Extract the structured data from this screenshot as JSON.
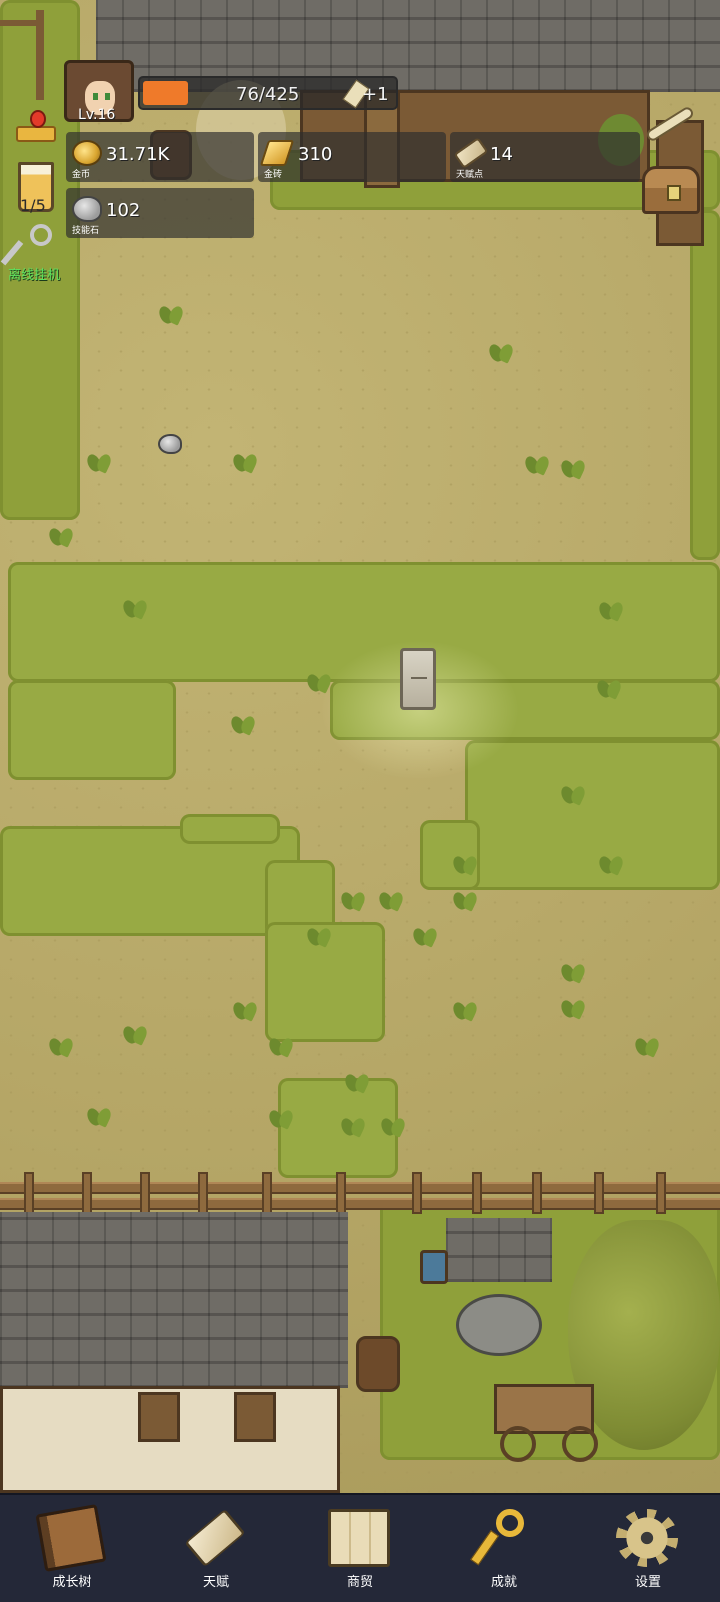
{
  "player": {
    "level_label": "Lv.16",
    "xp_text": "76/425",
    "xp_fraction": 0.179,
    "xp_bonus": "+1"
  },
  "resources": [
    {
      "id": "gold",
      "value": "31.71K",
      "label": "金币",
      "icon": "gold-coin-icon"
    },
    {
      "id": "gold-bar",
      "value": "310",
      "label": "金砖",
      "icon": "gold-bar-icon"
    },
    {
      "id": "talent",
      "value": "14",
      "label": "天赋点",
      "icon": "talent-scroll-icon"
    },
    {
      "id": "skill-stone",
      "value": "102",
      "label": "技能石",
      "icon": "skill-stone-icon"
    }
  ],
  "left_tools": {
    "cup_counter": "1/5",
    "idle_label": "离线挂机"
  },
  "nav": [
    {
      "label": "成长树",
      "icon": "book-icon"
    },
    {
      "label": "天赋",
      "icon": "scroll-icon"
    },
    {
      "label": "商贸",
      "icon": "map-icon"
    },
    {
      "label": "成就",
      "icon": "key-icon"
    },
    {
      "label": "设置",
      "icon": "gear-icon"
    }
  ],
  "colors": {
    "xp_fill": "#ef7a2a",
    "idle_text": "#5ee25e",
    "nav_bg": "#242838"
  }
}
